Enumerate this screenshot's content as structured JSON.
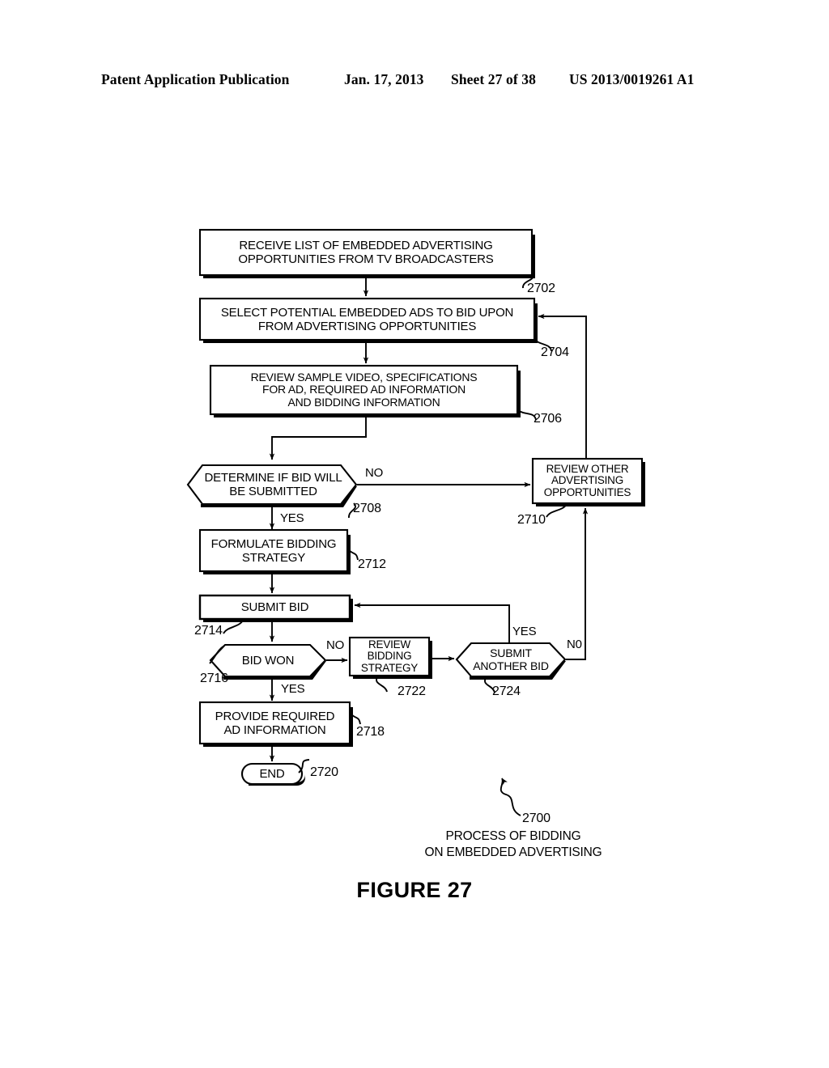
{
  "header": {
    "publication": "Patent Application Publication",
    "date": "Jan. 17, 2013",
    "sheet": "Sheet 27 of 38",
    "patent_number": "US 2013/0019261 A1"
  },
  "figure": {
    "title": "FIGURE 27",
    "caption_line1": "PROCESS OF BIDDING",
    "caption_line2": "ON EMBEDDED ADVERTISING",
    "caption_ref": "2700"
  },
  "nodes": {
    "n2702": {
      "ref": "2702",
      "shape": "process",
      "line1": "RECEIVE LIST OF EMBEDDED ADVERTISING",
      "line2": "OPPORTUNITIES FROM TV BROADCASTERS"
    },
    "n2704": {
      "ref": "2704",
      "shape": "process",
      "line1": "SELECT POTENTIAL EMBEDDED ADS TO BID UPON",
      "line2": "FROM ADVERTISING OPPORTUNITIES"
    },
    "n2706": {
      "ref": "2706",
      "shape": "process",
      "line1": "REVIEW SAMPLE VIDEO, SPECIFICATIONS",
      "line2": "FOR AD, REQUIRED AD INFORMATION",
      "line3": "AND BIDDING INFORMATION"
    },
    "n2708": {
      "ref": "2708",
      "shape": "decision-hexagon",
      "line1": "DETERMINE IF BID WILL",
      "line2": "BE SUBMITTED"
    },
    "n2710": {
      "ref": "2710",
      "shape": "process",
      "line1": "REVIEW OTHER",
      "line2": "ADVERTISING",
      "line3": "OPPORTUNITIES"
    },
    "n2712": {
      "ref": "2712",
      "shape": "process",
      "line1": "FORMULATE BIDDING",
      "line2": "STRATEGY"
    },
    "n2714": {
      "ref": "2714",
      "shape": "process",
      "line1": "SUBMIT BID"
    },
    "n2716": {
      "ref": "2716",
      "shape": "decision-hexagon",
      "line1": "BID WON"
    },
    "n2718": {
      "ref": "2718",
      "shape": "process",
      "line1": "PROVIDE REQUIRED",
      "line2": "AD INFORMATION"
    },
    "n2720": {
      "ref": "2720",
      "shape": "terminator",
      "line1": "END"
    },
    "n2722": {
      "ref": "2722",
      "shape": "process",
      "line1": "REVIEW",
      "line2": "BIDDING",
      "line3": "STRATEGY"
    },
    "n2724": {
      "ref": "2724",
      "shape": "decision-hexagon",
      "line1": "SUBMIT",
      "line2": "ANOTHER BID"
    }
  },
  "edge_labels": {
    "determine_no": "NO",
    "determine_yes": "YES",
    "bidwon_no": "NO",
    "bidwon_yes": "YES",
    "another_yes": "YES",
    "another_no": "N0"
  }
}
